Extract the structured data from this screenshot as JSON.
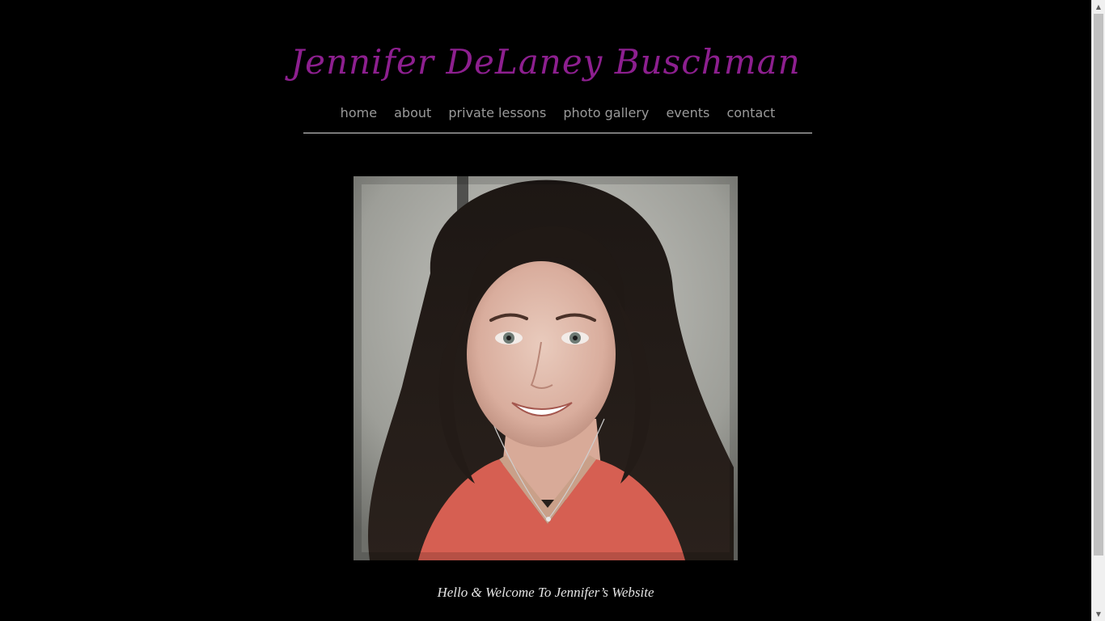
{
  "site": {
    "title": "Jennifer DeLaney Buschman",
    "title_color": "#8d1f8f"
  },
  "nav": {
    "items": [
      {
        "label": "home"
      },
      {
        "label": "about"
      },
      {
        "label": "private lessons"
      },
      {
        "label": "photo gallery"
      },
      {
        "label": "events"
      },
      {
        "label": "contact"
      }
    ]
  },
  "hero": {
    "image": "portrait-photo",
    "caption": "Hello & Welcome To Jennifer’s Website"
  },
  "scrollbar": {
    "up_icon": "chevron-up-icon",
    "down_icon": "chevron-down-icon"
  }
}
